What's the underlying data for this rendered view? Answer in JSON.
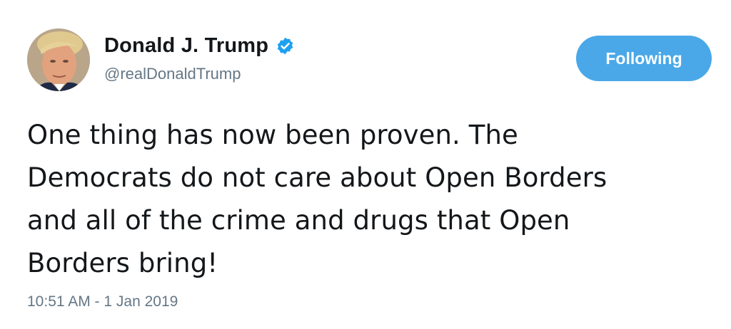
{
  "user": {
    "display_name": "Donald J. Trump",
    "handle": "@realDonaldTrump",
    "verified": true
  },
  "follow_button": {
    "label": "Following"
  },
  "tweet": {
    "text": "One thing has now been proven. The\nDemocrats do not care about Open Borders\nand all of the crime and drugs that Open\nBorders bring!",
    "timestamp": "10:51 AM - 1 Jan 2019"
  },
  "colors": {
    "accent": "#4aa8e8",
    "verified_badge": "#1da1f2",
    "secondary_text": "#657786",
    "primary_text": "#14171a"
  },
  "icons": {
    "verified": "verified-badge-icon"
  }
}
